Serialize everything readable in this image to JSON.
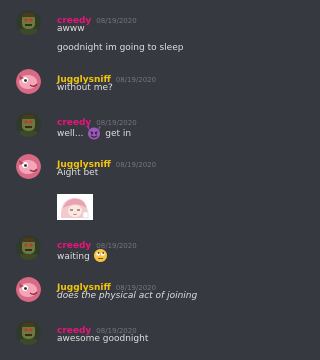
{
  "colors": {
    "background": "#36393f",
    "creedy_name": "#e9147a",
    "jugglysniff_name": "#f1c40f",
    "timestamp": "#72767d",
    "message_text": "#dcddde"
  },
  "users": {
    "creedy": {
      "name": "creedy",
      "avatar_icon": "zombie-avatar-icon"
    },
    "jugglysniff": {
      "name": "Jugglysniff",
      "avatar_icon": "pink-creature-avatar-icon"
    }
  },
  "messages": [
    {
      "author": "creedy",
      "timestamp": "08/19/2020",
      "lines": [
        "awww",
        "goodnight im going to sleep"
      ]
    },
    {
      "author": "Jugglysniff",
      "timestamp": "08/19/2020",
      "lines": [
        "without me?"
      ]
    },
    {
      "author": "creedy",
      "timestamp": "08/19/2020",
      "text_before": "well...",
      "emoji": "smiling-imp-emoji",
      "text_after": "get in"
    },
    {
      "author": "Jugglysniff",
      "timestamp": "08/19/2020",
      "lines": [
        "Aight bet"
      ],
      "sticker": "anime-girl-sticker"
    },
    {
      "author": "creedy",
      "timestamp": "08/19/2020",
      "text_before": "waiting",
      "emoji": "face-with-rolling-eyes-emoji"
    },
    {
      "author": "Jugglysniff",
      "timestamp": "08/19/2020",
      "lines": [
        "does the physical act of joining"
      ],
      "italic": true
    },
    {
      "author": "creedy",
      "timestamp": "08/19/2020",
      "lines": [
        "awesome goodnight"
      ]
    }
  ]
}
